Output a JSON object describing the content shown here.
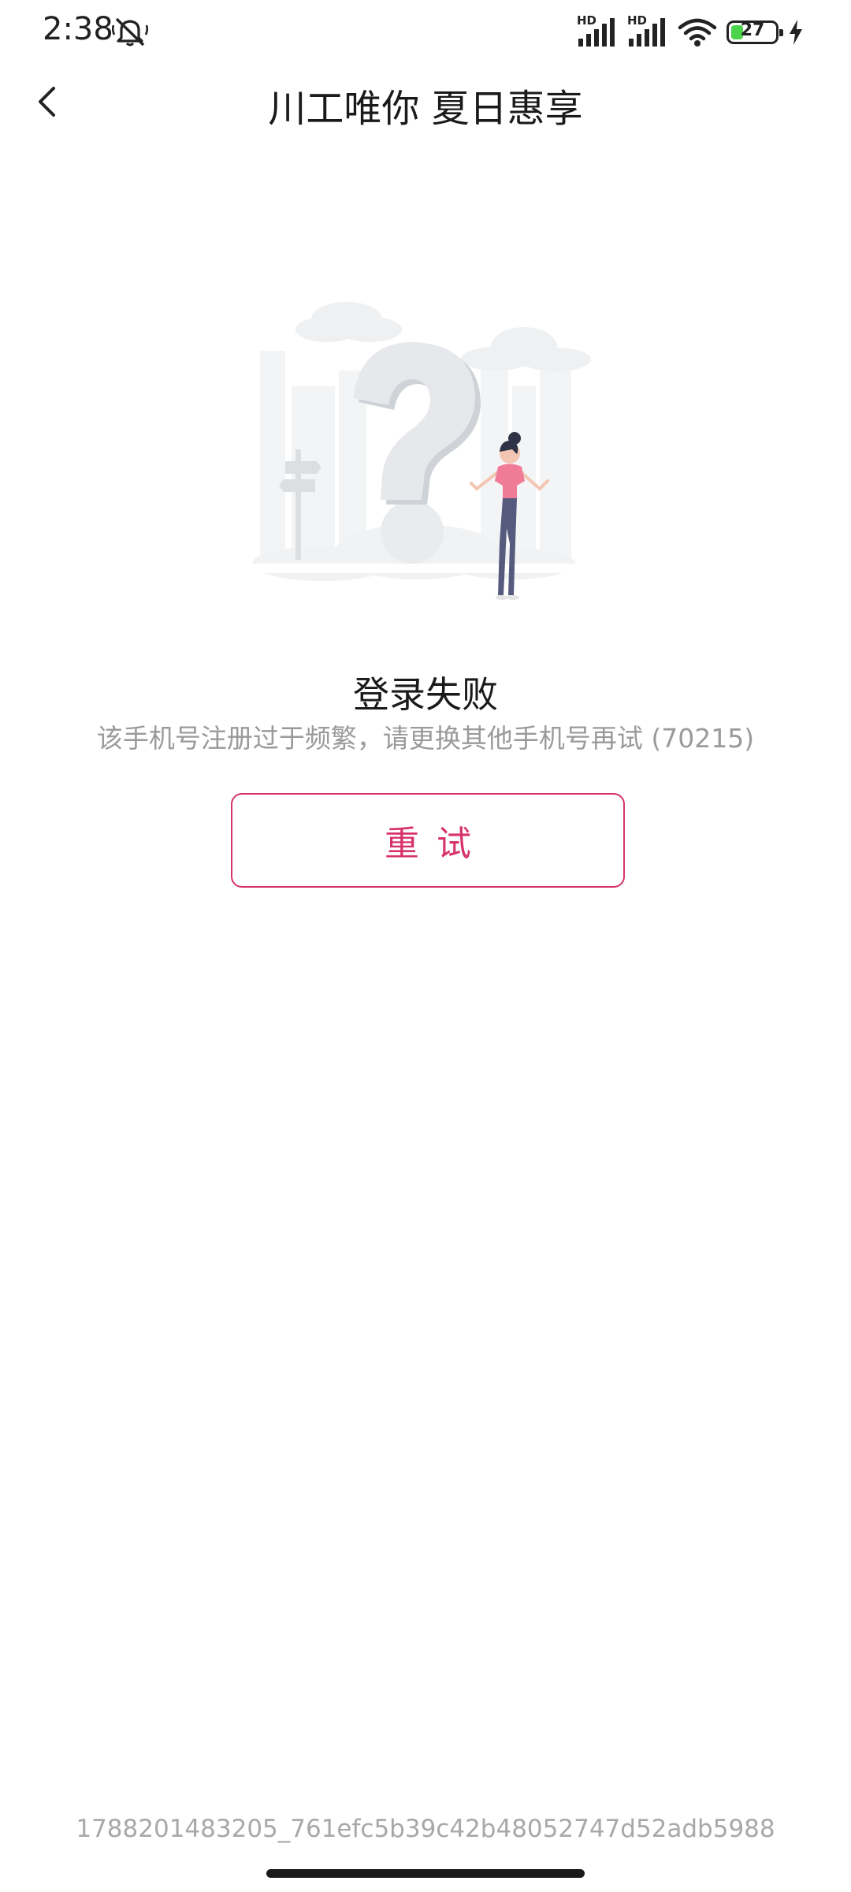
{
  "status_bar": {
    "time": "2:38",
    "mute_icon": "bell-off-icon",
    "signal_1_label": "HD",
    "signal_2_label": "HD",
    "wifi_icon": "wifi-icon",
    "battery_level": "27",
    "battery_fraction": 0.27,
    "charging_icon": "lightning-icon"
  },
  "nav": {
    "title": "川工唯你 夏日惠享",
    "back_icon": "chevron-left-icon"
  },
  "error": {
    "illustration": "question-mark-woman-illustration",
    "title": "登录失败",
    "message": "该手机号注册过于频繁，请更换其他手机号再试 (70215)"
  },
  "retry_button": {
    "label": "重试"
  },
  "footer": {
    "request_id": "1788201483205_761efc5b39c42b48052747d52adb5988"
  },
  "colors": {
    "accent": "#d6336c",
    "battery": "#4cd34c",
    "secondary_text": "#9a9a9a"
  }
}
